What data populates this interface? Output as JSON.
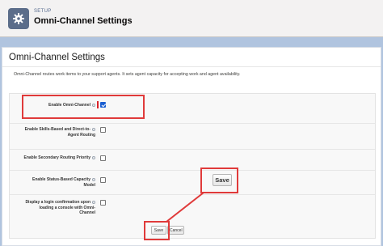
{
  "header": {
    "setup_label": "SETUP",
    "title": "Omni-Channel Settings",
    "icon": "gear-icon"
  },
  "main": {
    "title": "Omni-Channel Settings",
    "description": "Omni-Channel routes work items to your support agents. It sets agent capacity for accepting work and agent availability."
  },
  "settings": [
    {
      "label": "Enable Omni-Channel",
      "checked": true
    },
    {
      "label": "Enable Skills-Based and Direct-to-Agent Routing",
      "line1": "Enable Skills-Based and Direct-to-",
      "line2": "Agent Routing",
      "checked": false
    },
    {
      "label": "Enable Secondary Routing Priority",
      "checked": false
    },
    {
      "label": "Enable Status-Based Capacity Model",
      "line1": "Enable Status-Based Capacity",
      "line2": "Model",
      "checked": false
    },
    {
      "label": "Display a login confirmation upon loading a console with Omni-Channel",
      "line1": "Display a login confirmation upon",
      "line2": "loading a console with Omni-",
      "line3": "Channel",
      "checked": false
    }
  ],
  "buttons": {
    "save": "Save",
    "cancel": "Cancel",
    "save_callout": "Save"
  },
  "colors": {
    "accent": "#1b5fd1",
    "highlight": "#e03a3a",
    "background": "#b0c4df"
  }
}
